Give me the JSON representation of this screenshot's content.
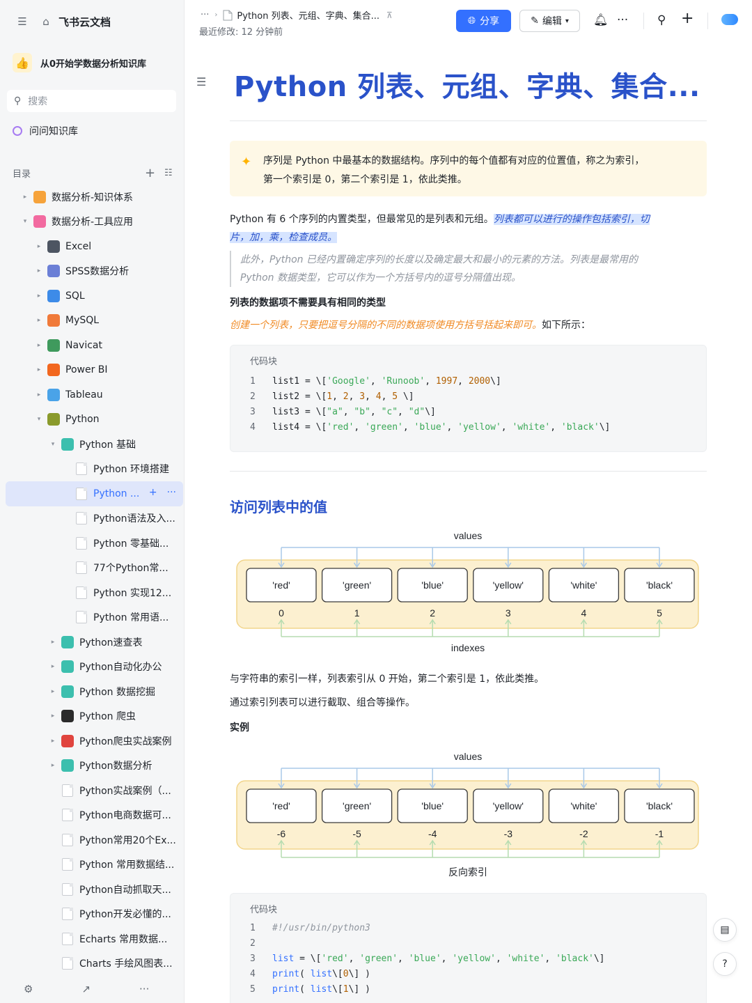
{
  "sidebar": {
    "brand": "飞书云文档",
    "knowledge_base": "从0开始学数据分析知识库",
    "search_placeholder": "搜索",
    "ask_label": "问问知识库",
    "toc_label": "目录",
    "items": [
      {
        "label": "数据分析-知识体系",
        "level": 0,
        "arrow": "▸",
        "icon": "orange-folder-icon",
        "color": "#f6a33b"
      },
      {
        "label": "数据分析-工具应用",
        "level": 0,
        "arrow": "▾",
        "icon": "pink-folder-icon",
        "color": "#f26aa0"
      },
      {
        "label": "Excel",
        "level": 1,
        "arrow": "▸",
        "icon": "excel-icon",
        "color": "#4d5562"
      },
      {
        "label": "SPSS数据分析",
        "level": 1,
        "arrow": "▸",
        "icon": "spss-icon",
        "color": "#6b7fd6"
      },
      {
        "label": "SQL",
        "level": 1,
        "arrow": "▸",
        "icon": "sql-icon",
        "color": "#3d8be8"
      },
      {
        "label": "MySQL",
        "level": 1,
        "arrow": "▸",
        "icon": "mysql-icon",
        "color": "#f07a3a"
      },
      {
        "label": "Navicat",
        "level": 1,
        "arrow": "▸",
        "icon": "navicat-icon",
        "color": "#3f9a5d"
      },
      {
        "label": "Power BI",
        "level": 1,
        "arrow": "▸",
        "icon": "power-bi-icon",
        "color": "#f2671f"
      },
      {
        "label": "Tableau",
        "level": 1,
        "arrow": "▸",
        "icon": "tableau-icon",
        "color": "#4aa3e8"
      },
      {
        "label": "Python",
        "level": 1,
        "arrow": "▾",
        "icon": "python-icon",
        "color": "#8a9a2c"
      },
      {
        "label": "Python 基础",
        "level": 2,
        "arrow": "▾",
        "icon": "teal-folder-icon",
        "color": "#3cbfae"
      },
      {
        "label": "Python 环境搭建",
        "level": 3,
        "arrow": "",
        "icon": "doc-icon",
        "color": ""
      },
      {
        "label": "Python ...",
        "level": 3,
        "arrow": "",
        "icon": "doc-icon",
        "color": "",
        "active": true
      },
      {
        "label": "Python语法及入...",
        "level": 3,
        "arrow": "",
        "icon": "doc-icon",
        "color": ""
      },
      {
        "label": "Python 零基础...",
        "level": 3,
        "arrow": "",
        "icon": "doc-icon",
        "color": ""
      },
      {
        "label": "77个Python常...",
        "level": 3,
        "arrow": "",
        "icon": "doc-icon",
        "color": ""
      },
      {
        "label": "Python 实现12...",
        "level": 3,
        "arrow": "",
        "icon": "doc-icon",
        "color": ""
      },
      {
        "label": "Python 常用语...",
        "level": 3,
        "arrow": "",
        "icon": "doc-icon",
        "color": ""
      },
      {
        "label": "Python速查表",
        "level": 2,
        "arrow": "▸",
        "icon": "teal-folder-icon",
        "color": "#3cbfae"
      },
      {
        "label": "Python自动化办公",
        "level": 2,
        "arrow": "▸",
        "icon": "teal-folder-icon",
        "color": "#3cbfae"
      },
      {
        "label": "Python 数据挖掘",
        "level": 2,
        "arrow": "▸",
        "icon": "teal-folder-icon",
        "color": "#3cbfae"
      },
      {
        "label": "Python 爬虫",
        "level": 2,
        "arrow": "▸",
        "icon": "spider-icon",
        "color": "#2b2b2b"
      },
      {
        "label": "Python爬虫实战案例",
        "level": 2,
        "arrow": "▸",
        "icon": "target-icon",
        "color": "#e0443e"
      },
      {
        "label": "Python数据分析",
        "level": 2,
        "arrow": "▸",
        "icon": "teal-folder-icon",
        "color": "#3cbfae"
      },
      {
        "label": "Python实战案例（...",
        "level": 2,
        "arrow": "",
        "icon": "doc-icon",
        "color": ""
      },
      {
        "label": "Python电商数据可...",
        "level": 2,
        "arrow": "",
        "icon": "doc-icon",
        "color": ""
      },
      {
        "label": "Python常用20个Ex...",
        "level": 2,
        "arrow": "",
        "icon": "doc-icon",
        "color": ""
      },
      {
        "label": "Python 常用数据结...",
        "level": 2,
        "arrow": "",
        "icon": "doc-icon",
        "color": ""
      },
      {
        "label": "Python自动抓取天...",
        "level": 2,
        "arrow": "",
        "icon": "doc-icon",
        "color": ""
      },
      {
        "label": "Python开发必懂的...",
        "level": 2,
        "arrow": "",
        "icon": "doc-icon",
        "color": ""
      },
      {
        "label": "Echarts 常用数据...",
        "level": 2,
        "arrow": "",
        "icon": "chart-doc-icon",
        "color": ""
      },
      {
        "label": "Charts 手绘风图表...",
        "level": 2,
        "arrow": "",
        "icon": "chart-doc-icon",
        "color": ""
      }
    ]
  },
  "header": {
    "breadcrumb_more": "···",
    "breadcrumb_title": "Python 列表、元组、字典、集合...",
    "modified": "最近修改: 12 分钟前",
    "share_label": "分享",
    "edit_label": "编辑"
  },
  "doc": {
    "title": "Python 列表、元组、字典、集合...",
    "callout_line1": "序列是 Python 中最基本的数据结构。序列中的每个值都有对应的位置值，称之为索引，",
    "callout_line2": "第一个索引是 0，第二个索引是 1，依此类推。",
    "p1_plain": "Python 有 6 个序列的内置类型，但最常见的是列表和元组。",
    "p1_hl_a": "列表都可以进行的操作包括索引，切",
    "p1_hl_b": "片，加，乘，检查成员。",
    "quote_line1": "此外，Python 已经内置确定序列的长度以及确定最大和最小的元素的方法。列表是最常用的",
    "quote_line2": "Python 数据类型，它可以作为一个方括号内的逗号分隔值出现。",
    "bold1": "列表的数据项不需要具有相同的类型",
    "p2_orange": "创建一个列表，只要把逗号分隔的不同的数据项使用方括号括起来即可。",
    "p2_plain": "如下所示：",
    "code_caption": "代码块",
    "code1": [
      {
        "ln": "1",
        "text": "list1 = \\['Google', 'Runoob', 1997, 2000\\]"
      },
      {
        "ln": "2",
        "text": "list2 = \\[1, 2, 3, 4, 5 \\]"
      },
      {
        "ln": "3",
        "text": "list3 = \\[\"a\", \"b\", \"c\", \"d\"\\]"
      },
      {
        "ln": "4",
        "text": "list4 = \\['red', 'green', 'blue', 'yellow', 'white', 'black'\\]"
      }
    ],
    "h2": "访问列表中的值",
    "diagram1": {
      "top_label": "values",
      "bottom_label": "indexes",
      "values": [
        "'red'",
        "'green'",
        "'blue'",
        "'yellow'",
        "'white'",
        "'black'"
      ],
      "indexes": [
        "0",
        "1",
        "2",
        "3",
        "4",
        "5"
      ]
    },
    "p3": "与字符串的索引一样，列表索引从 0 开始，第二个索引是 1，依此类推。",
    "p4": "通过索引列表可以进行截取、组合等操作。",
    "bold2": "实例",
    "diagram2": {
      "top_label": "values",
      "bottom_label": "反向索引",
      "values": [
        "'red'",
        "'green'",
        "'blue'",
        "'yellow'",
        "'white'",
        "'black'"
      ],
      "indexes": [
        "-6",
        "-5",
        "-4",
        "-3",
        "-2",
        "-1"
      ]
    },
    "code2": [
      {
        "ln": "1",
        "text": "#!/usr/bin/python3"
      },
      {
        "ln": "2",
        "text": ""
      },
      {
        "ln": "3",
        "text": "list = \\['red', 'green', 'blue', 'yellow', 'white', 'black'\\]"
      },
      {
        "ln": "4",
        "text": "print( list\\[0\\] )"
      },
      {
        "ln": "5",
        "text": "print( list\\[1\\] )"
      }
    ]
  },
  "colors": {
    "accent": "#3370ff",
    "title": "#2a52c9",
    "callout_bg": "#fef8e6",
    "diagram_bg": "#fcf0d0",
    "diagram_border": "#f2d58c",
    "arrow": "#a9c9e8",
    "arrow_up": "#b5dcb0"
  }
}
